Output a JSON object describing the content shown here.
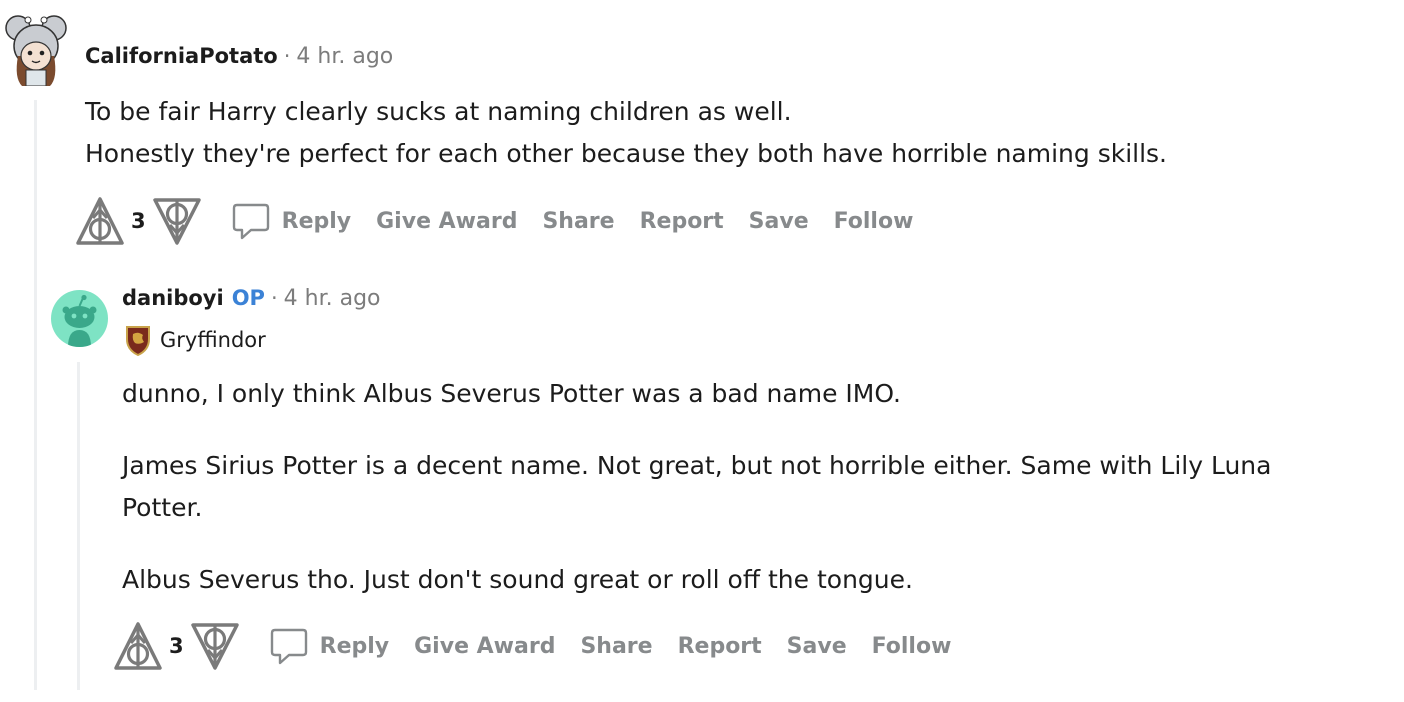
{
  "comments": [
    {
      "author": "CaliforniaPotato",
      "separator": "·",
      "time": "4 hr. ago",
      "avatar_icon": "koala-avatar-icon",
      "body": [
        "To be fair Harry clearly sucks at naming children as well.",
        "Honestly they're perfect for each other because they both have horrible naming skills."
      ],
      "score": "3",
      "actions": {
        "reply": "Reply",
        "give_award": "Give Award",
        "share": "Share",
        "report": "Report",
        "save": "Save",
        "follow": "Follow"
      }
    },
    {
      "author": "daniboyi",
      "op_badge": "OP",
      "separator": "·",
      "time": "4 hr. ago",
      "avatar_icon": "snoo-avatar-icon",
      "flair": "Gryffindor",
      "flair_icon": "gryffindor-crest-icon",
      "body": [
        "dunno, I only think Albus Severus Potter was a bad name IMO.",
        "James Sirius Potter is a decent name. Not great, but not horrible either. Same with Lily Luna Potter.",
        "Albus Severus tho. Just don't sound great or roll off the tongue."
      ],
      "score": "3",
      "actions": {
        "reply": "Reply",
        "give_award": "Give Award",
        "share": "Share",
        "report": "Report",
        "save": "Save",
        "follow": "Follow"
      }
    }
  ],
  "colors": {
    "op": "#3b82d6",
    "action_text": "#878a8c",
    "meta_text": "#7c7c7c",
    "thread_line": "#edeff1",
    "snoo_bg": "#7ee3c4"
  }
}
